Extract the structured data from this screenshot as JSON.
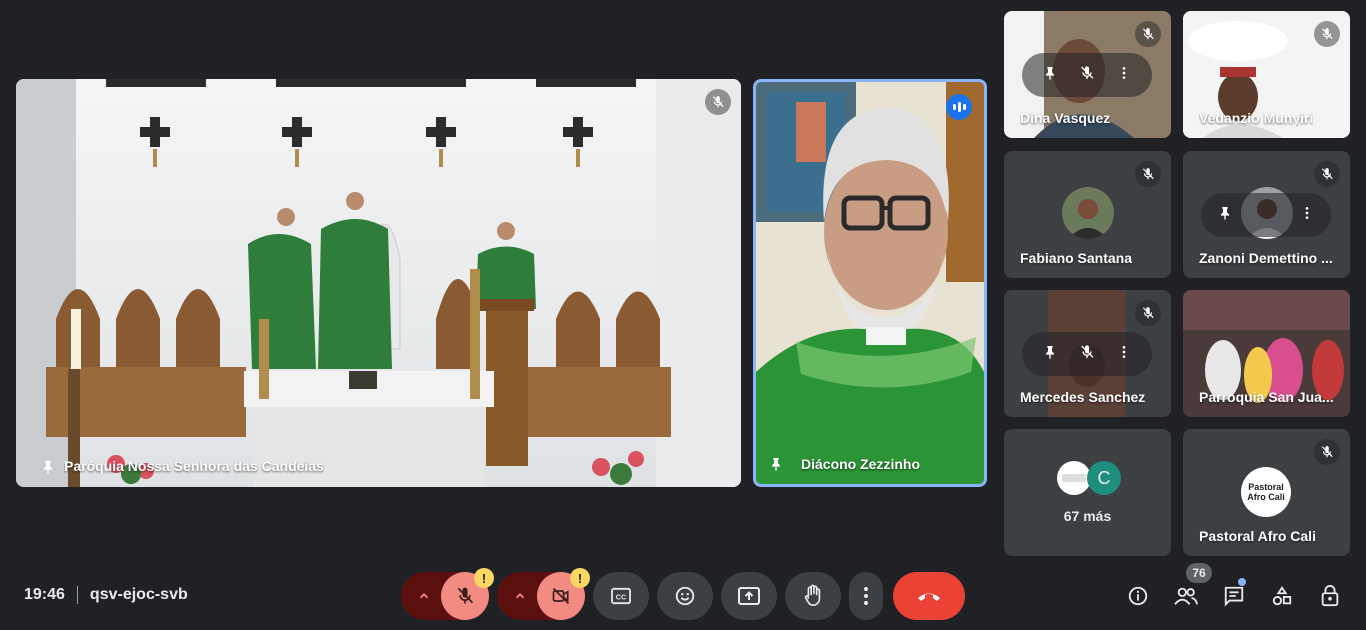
{
  "meeting": {
    "time": "19:46",
    "code": "qsv-ejoc-svb"
  },
  "main_tile": {
    "name": "Paróquia Nossa Senhora das Candeias"
  },
  "speaker_tile": {
    "name": "Diácono Zezzinho"
  },
  "participants": [
    {
      "name": "Dina Vasquez"
    },
    {
      "name": "Vedanzio Munyiri"
    },
    {
      "name": "Fabiano Santana"
    },
    {
      "name": "Zanoni Demettino ..."
    },
    {
      "name": "Mercedes Sanchez"
    },
    {
      "name": "Parroquia San Jua..."
    },
    {
      "name": "67 más",
      "avatar_letter": "C"
    },
    {
      "name": "Pastoral Afro Cali",
      "logo_text": "Pastoral Afro Cali"
    }
  ],
  "controls": {
    "warning_glyph": "!",
    "participants_count": "76"
  },
  "colors": {
    "background": "#202124",
    "tile": "#3c4043",
    "accent": "#8ab4f8",
    "end_call": "#ea4335",
    "muted": "#f28b82",
    "warning": "#fdd663",
    "avatar_c": "#1e8e7e"
  },
  "icons": [
    "mic-off-icon",
    "pin-icon",
    "more-vert-icon",
    "speaking-icon",
    "chevron-up-icon",
    "camera-off-icon",
    "captions-icon",
    "emoji-icon",
    "present-icon",
    "raise-hand-icon",
    "end-call-icon",
    "info-icon",
    "people-icon",
    "chat-icon",
    "activities-icon",
    "host-controls-icon"
  ]
}
